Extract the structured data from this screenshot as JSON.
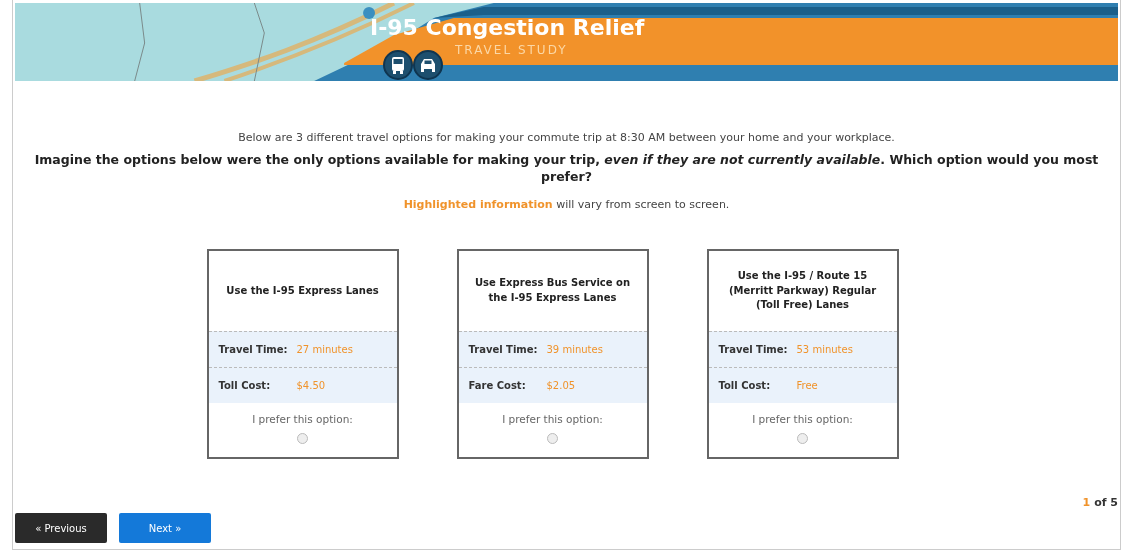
{
  "banner": {
    "kind": "picture",
    "title": "I-95 Congestion Relief",
    "subtitle": "TRAVEL STUDY"
  },
  "intro": "Below are 3 different travel options for making your commute trip at 8:30 AM between your home and your workplace.",
  "question": "Imagine the options below were the only options available for making your trip, *even if they are not currently available*. Which option would you most prefer?",
  "note": "**Highlighted information** will vary from screen to screen.",
  "options": [
    {
      "title": "Use the I-95 Express Lanes",
      "rows": [
        {
          "label": "Travel Time:",
          "value": "27 minutes"
        },
        {
          "label": "Toll Cost:",
          "value": "$4.50"
        }
      ],
      "prompt": "I prefer this option:",
      "selected": false
    },
    {
      "title": "Use Express Bus Service on the I-95 Express Lanes",
      "rows": [
        {
          "label": "Travel Time:",
          "value": "39 minutes"
        },
        {
          "label": "Fare Cost:",
          "value": "$2.05"
        }
      ],
      "prompt": "I prefer this option:",
      "selected": false
    },
    {
      "title": "Use the I-95 / Route 15 (Merritt Parkway) Regular (Toll Free) Lanes",
      "rows": [
        {
          "label": "Travel Time:",
          "value": "53 minutes"
        },
        {
          "label": "Toll Cost:",
          "value": "Free"
        }
      ],
      "prompt": "I prefer this option:",
      "selected": false
    }
  ],
  "pager": {
    "current": "1",
    "total": "of 5"
  },
  "buttons": [
    {
      "label": "« Previous",
      "kind": "secondary"
    },
    {
      "label": "Next »",
      "kind": "primary"
    }
  ]
}
